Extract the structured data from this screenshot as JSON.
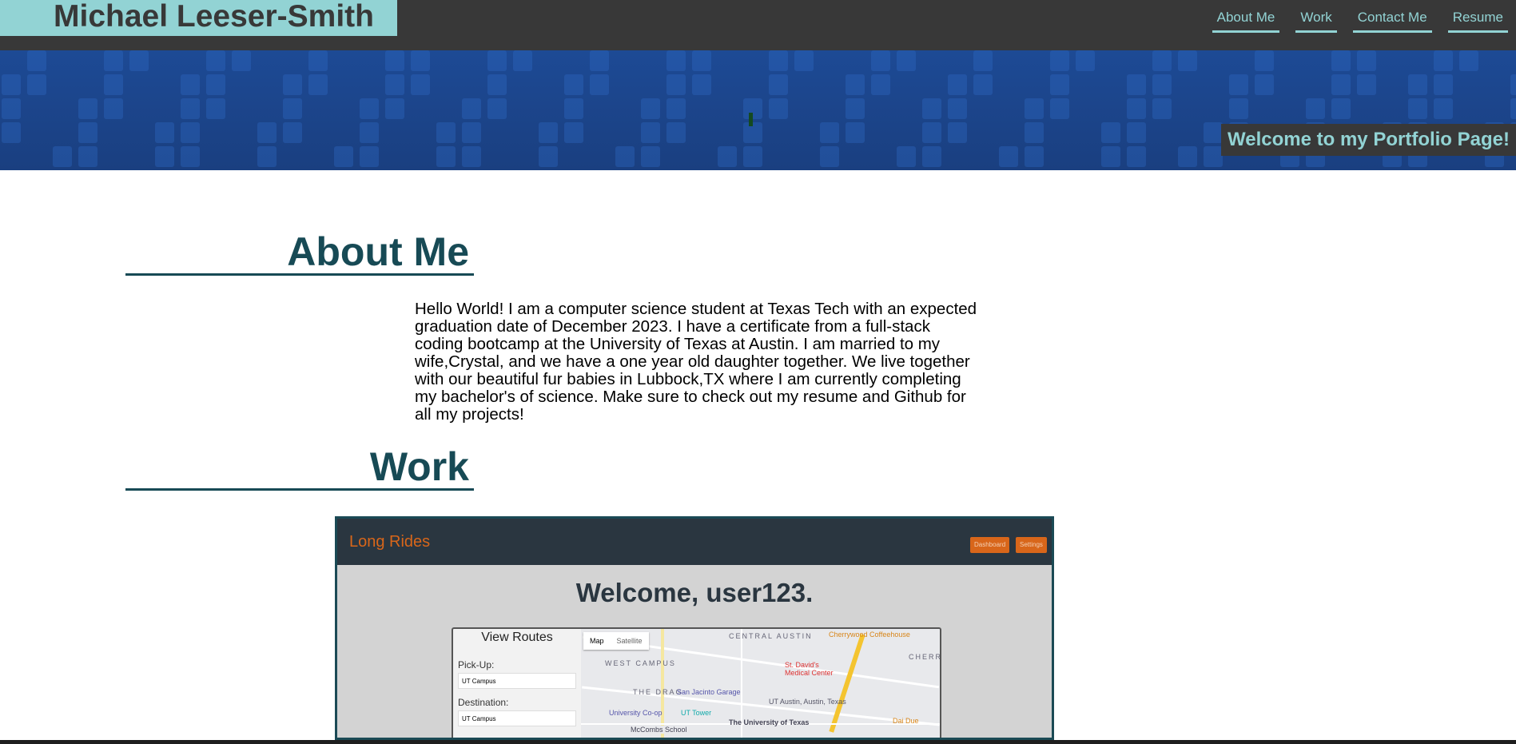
{
  "header": {
    "name": "Michael Leeser-Smith",
    "nav": [
      {
        "label": "About Me"
      },
      {
        "label": "Work"
      },
      {
        "label": "Contact Me"
      },
      {
        "label": "Resume"
      }
    ]
  },
  "hero": {
    "welcome": "Welcome to my Portfolio Page!"
  },
  "about": {
    "title": "About Me",
    "text": "Hello World! I am a computer science student at Texas Tech with an expected graduation date of December 2023. I have a certificate from a full-stack coding bootcamp at the University of Texas at Austin. I am married to my wife,Crystal, and we have a one year old daughter together. We live together with our beautiful fur babies in Lubbock,TX where I am currently completing my bachelor's of science. Make sure to check out my resume and Github for all my projects!"
  },
  "work": {
    "title": "Work",
    "project": {
      "brand": "Long Rides",
      "buttons": [
        "Dashboard",
        "Settings"
      ],
      "welcome": "Welcome, user123.",
      "panel_title": "View Routes",
      "pickup_label": "Pick-Up:",
      "pickup_value": "UT Campus",
      "destination_label": "Destination:",
      "destination_value": "UT Campus",
      "map_types": [
        "Map",
        "Satellite"
      ],
      "map_labels": [
        "CENTRAL AUSTIN",
        "WEST CAMPUS",
        "THE DRAG",
        "CHERRYW",
        "St. David's Medical Center",
        "San Jacinto Garage",
        "University Co-op",
        "UT Tower",
        "The University of Texas",
        "Cherrywood Coffeehouse",
        "Dai Due",
        "UT Austin, Austin, Texas",
        "McCombs School"
      ]
    }
  },
  "colors": {
    "accent": "#92d3d4",
    "header_bg": "#383838",
    "heading": "#174a55",
    "project_accent": "#d8661a"
  }
}
